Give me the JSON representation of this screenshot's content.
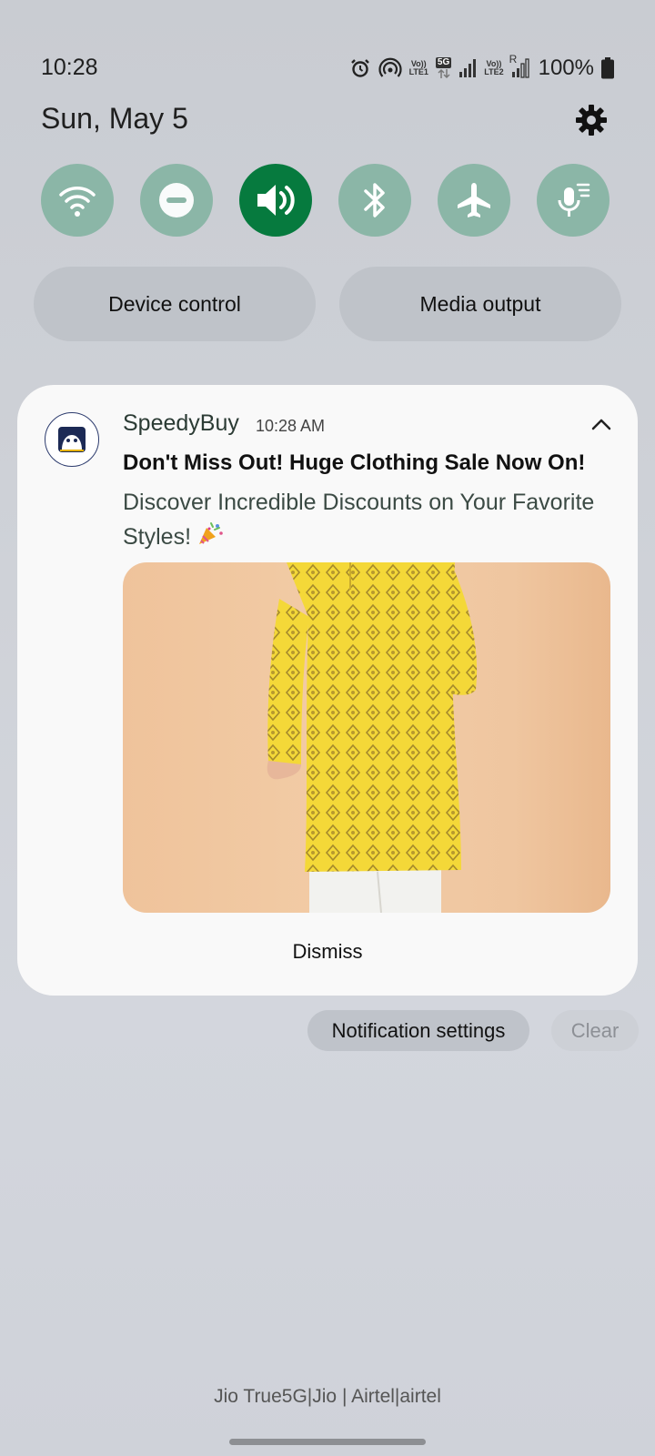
{
  "status_bar": {
    "time": "10:28",
    "battery": "100%",
    "icons": [
      "alarm-icon",
      "hotspot-icon",
      "volte-lte1-icon",
      "5g-icon",
      "signal-sim1-icon",
      "volte-lte2-icon",
      "signal-sim2-roaming-icon",
      "battery-icon"
    ],
    "lte1": "LTE1",
    "lte2": "LTE2",
    "vo": "Vo))",
    "fiveg": "5G",
    "roaming": "R"
  },
  "header": {
    "date": "Sun, May 5"
  },
  "quick_settings": {
    "toggles": [
      {
        "name": "wifi",
        "active": false
      },
      {
        "name": "do-not-disturb",
        "active": false
      },
      {
        "name": "sound",
        "active": true
      },
      {
        "name": "bluetooth",
        "active": false
      },
      {
        "name": "airplane-mode",
        "active": false
      },
      {
        "name": "live-caption-mic",
        "active": false
      }
    ],
    "device_control": "Device control",
    "media_output": "Media output"
  },
  "notification": {
    "app_name": "SpeedyBuy",
    "time": "10:28 AM",
    "title": "Don't Miss Out! Huge Clothing Sale Now On!",
    "body": "Discover Incredible Discounts on Your Favorite Styles!",
    "dismiss": "Dismiss"
  },
  "footer_actions": {
    "notification_settings": "Notification settings",
    "clear": "Clear"
  },
  "carrier": "Jio True5G|Jio | Airtel|airtel",
  "colors": {
    "accent_active": "#067a3e",
    "toggle_inactive": "#8bb6a7",
    "card_bg": "#f9f9f9"
  }
}
